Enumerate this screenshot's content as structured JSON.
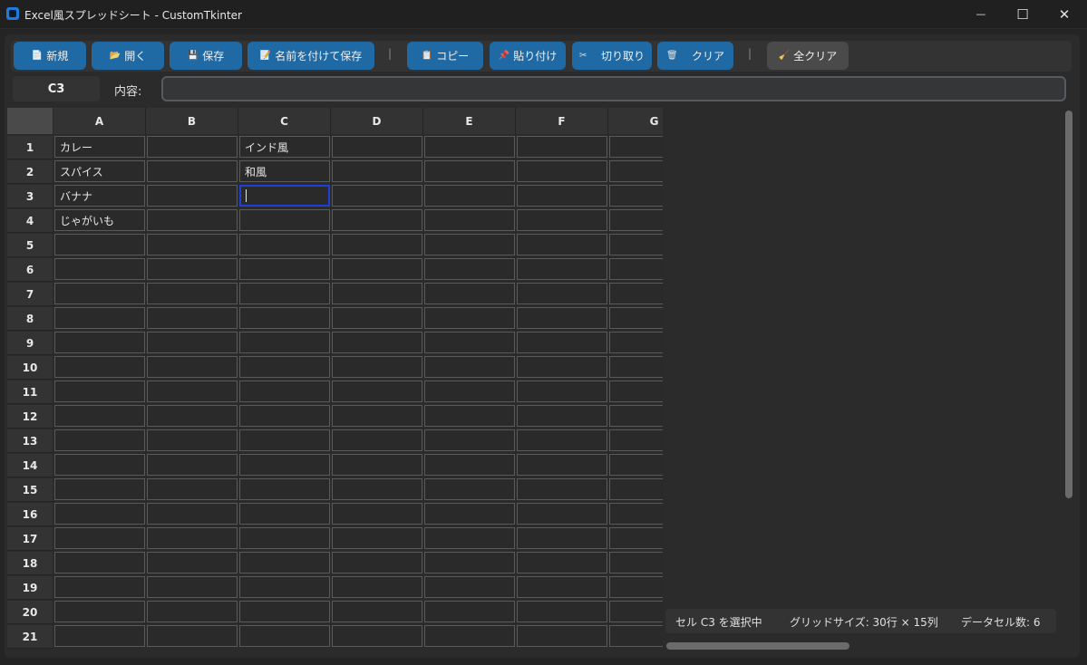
{
  "window": {
    "title": "Excel風スプレッドシート - CustomTkinter",
    "minimize_glyph": "—",
    "maximize_glyph": "☐",
    "close_glyph": "✕"
  },
  "toolbar": {
    "buttons": [
      {
        "label": "新規",
        "icon": "📄"
      },
      {
        "label": "開く",
        "icon": "📂"
      },
      {
        "label": "保存",
        "icon": "💾"
      },
      {
        "label": "名前を付けて保存",
        "icon": "📝"
      },
      {
        "label": "コピー",
        "icon": "📋"
      },
      {
        "label": "貼り付け",
        "icon": "📌"
      },
      {
        "label": "切り取り",
        "icon": "✂"
      },
      {
        "label": "クリア",
        "icon": "🗑"
      },
      {
        "label": "全クリア",
        "icon": "🧹"
      }
    ],
    "separator": "|"
  },
  "formula_bar": {
    "cell_ref": "C3",
    "content_label": "内容:",
    "content_value": ""
  },
  "grid": {
    "columns": [
      "A",
      "B",
      "C",
      "D",
      "E",
      "F",
      "G"
    ],
    "rows": [
      "1",
      "2",
      "3",
      "4",
      "5",
      "6",
      "7",
      "8",
      "9",
      "10",
      "11",
      "12",
      "13",
      "14",
      "15",
      "16",
      "17",
      "18",
      "19",
      "20",
      "21"
    ],
    "cells": {
      "A1": "カレー",
      "A2": "スパイス",
      "A3": "バナナ",
      "A4": "じゃがいも",
      "C1": "インド風",
      "C2": "和風"
    },
    "active_cell": "C3"
  },
  "status": {
    "selection": "セル C3 を選択中",
    "grid_size": "グリッドサイズ: 30行 × 15列",
    "data_count": "データセル数: 6"
  }
}
